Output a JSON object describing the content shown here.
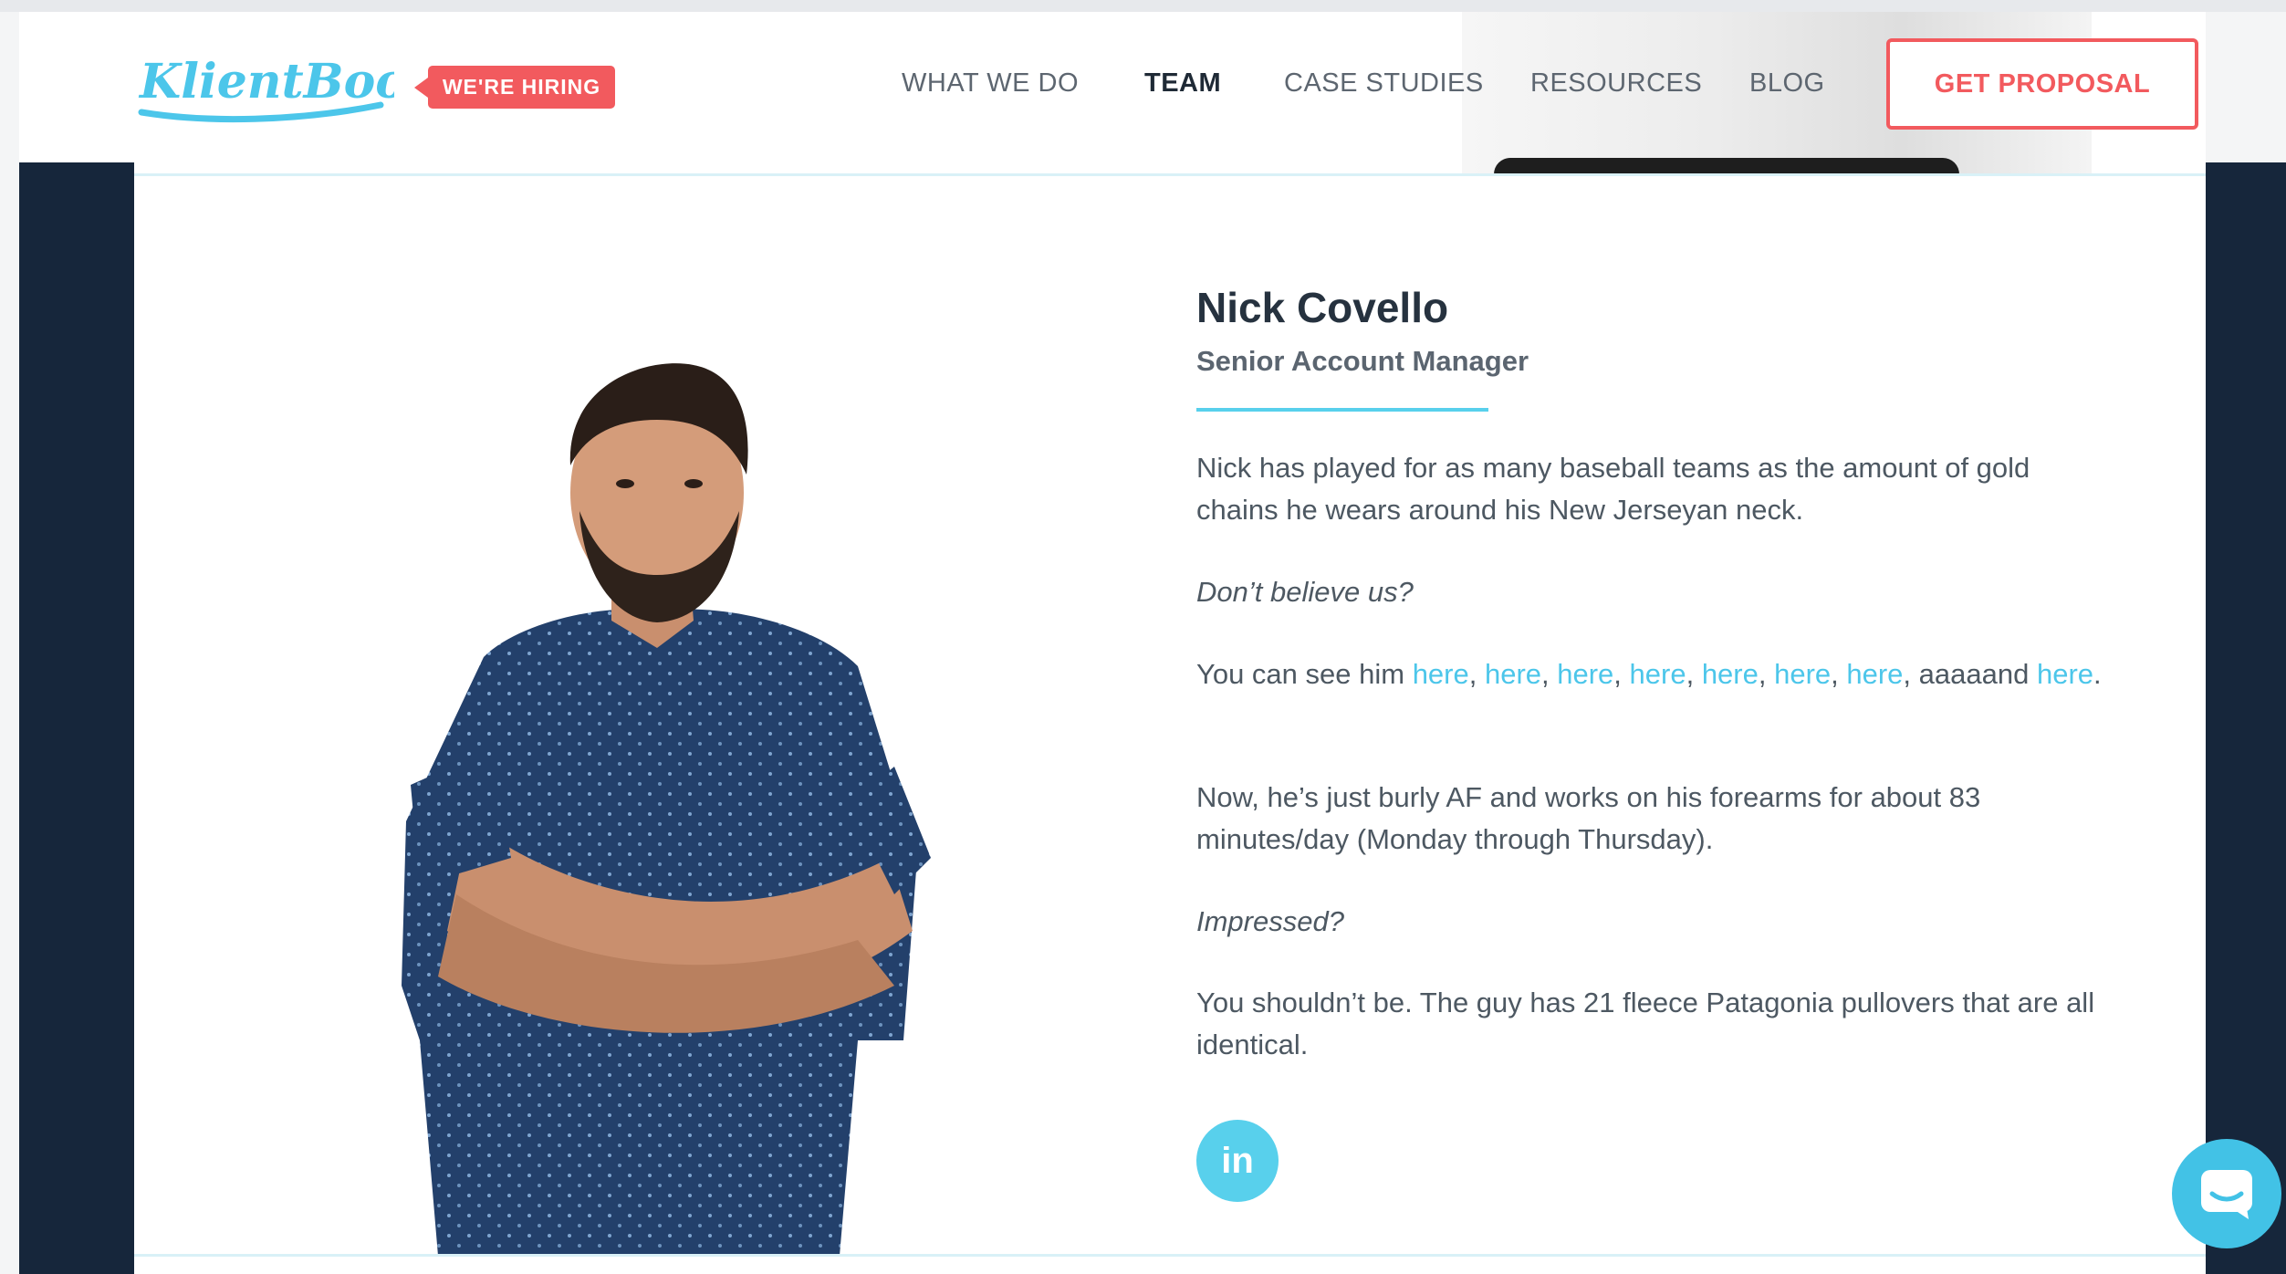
{
  "brand": {
    "logo_text": "KlientBoost",
    "hiring_badge": "WE'RE HIRING",
    "accent": "#f25a5e",
    "link_color": "#4cc6ea"
  },
  "nav": {
    "items": [
      {
        "label": "WHAT WE DO"
      },
      {
        "label": "TEAM",
        "active": true
      },
      {
        "label": "CASE STUDIES"
      },
      {
        "label": "RESOURCES"
      },
      {
        "label": "BLOG"
      }
    ],
    "cta": "GET PROPOSAL"
  },
  "profile": {
    "name": "Nick Covello",
    "title": "Senior Account Manager",
    "bio": {
      "p1": "Nick has played for as many baseball teams as the amount of gold chains he wears around his New Jerseyan neck.",
      "p2": "Don’t believe us?",
      "p3_prefix": "You can see him ",
      "links": [
        "here",
        "here",
        "here",
        "here",
        "here",
        "here",
        "here"
      ],
      "p3_and": ", aaaaand",
      "last_link": "here",
      "p3_suffix": ".",
      "p4": "Now, he’s just burly AF and works on his forearms for about 83 minutes/day (Monday through Thursday).",
      "p5": "Impressed?",
      "p6": "You shouldn’t be. The guy has 21 fleece Patagonia pullovers that are all identical."
    },
    "social": {
      "linkedin_label": "in"
    }
  },
  "icons": {
    "social": "linkedin-icon",
    "chat": "chat-bubble-icon"
  }
}
